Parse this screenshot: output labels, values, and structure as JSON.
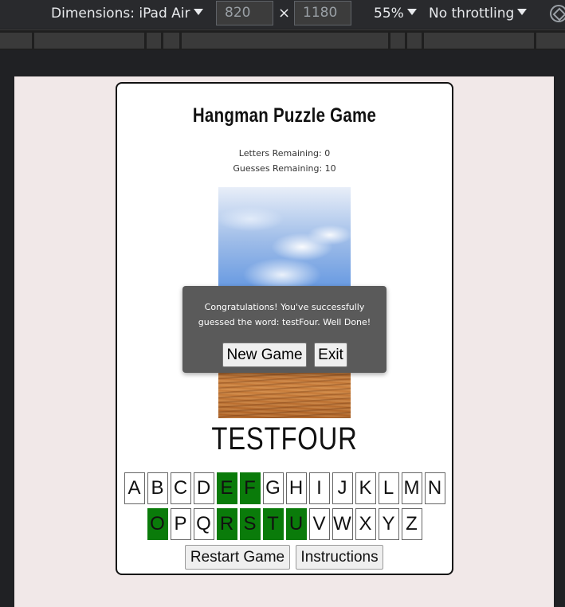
{
  "devtools": {
    "dimensions_label": "Dimensions: iPad Air",
    "width_value": "820",
    "times": "×",
    "height_value": "1180",
    "zoom": "55%",
    "throttling": "No throttling"
  },
  "game": {
    "title": "Hangman Puzzle Game",
    "letters_remaining": "Letters Remaining: 0",
    "guesses_remaining": "Guesses Remaining: 10",
    "word": "TESTFOUR",
    "modal": {
      "message": "Congratulations! You've successfully guessed the word: testFour. Well Done!",
      "new_game_label": "New Game",
      "exit_label": "Exit"
    },
    "letters_row1": [
      {
        "letter": "A",
        "used": false
      },
      {
        "letter": "B",
        "used": false
      },
      {
        "letter": "C",
        "used": false
      },
      {
        "letter": "D",
        "used": false
      },
      {
        "letter": "E",
        "used": true
      },
      {
        "letter": "F",
        "used": true
      },
      {
        "letter": "G",
        "used": false
      },
      {
        "letter": "H",
        "used": false
      },
      {
        "letter": "I",
        "used": false
      },
      {
        "letter": "J",
        "used": false
      },
      {
        "letter": "K",
        "used": false
      },
      {
        "letter": "L",
        "used": false
      },
      {
        "letter": "M",
        "used": false
      },
      {
        "letter": "N",
        "used": false
      }
    ],
    "letters_row2": [
      {
        "letter": "O",
        "used": true
      },
      {
        "letter": "P",
        "used": false
      },
      {
        "letter": "Q",
        "used": false
      },
      {
        "letter": "R",
        "used": true
      },
      {
        "letter": "S",
        "used": true
      },
      {
        "letter": "T",
        "used": true
      },
      {
        "letter": "U",
        "used": true
      },
      {
        "letter": "V",
        "used": false
      },
      {
        "letter": "W",
        "used": false
      },
      {
        "letter": "X",
        "used": false
      },
      {
        "letter": "Y",
        "used": false
      },
      {
        "letter": "Z",
        "used": false
      }
    ],
    "restart_label": "Restart Game",
    "instructions_label": "Instructions"
  },
  "colors": {
    "used_letter": "#0a7b0a",
    "page_background": "#f1e8e8",
    "modal_background": "#5a5a5a"
  }
}
